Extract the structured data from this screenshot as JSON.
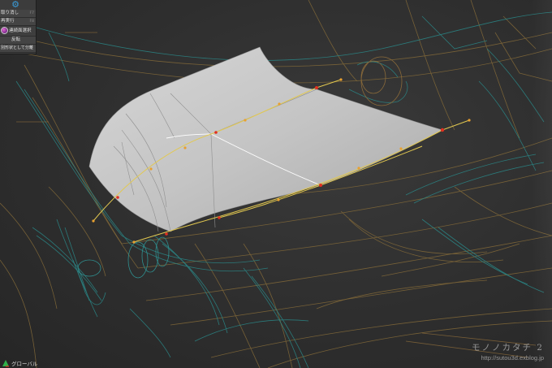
{
  "tool_panel": {
    "gear_icon": "gear-icon",
    "accent": "#3a9bd8",
    "items": [
      {
        "label": "取り消し",
        "shortcut": "F7"
      },
      {
        "label": "再実行",
        "shortcut": "F8"
      },
      {
        "label": "連続面選択",
        "icon": "sphere-icon"
      },
      {
        "label": "反転"
      },
      {
        "label": "別形状として分離"
      }
    ]
  },
  "global_button": {
    "label": "グローバル",
    "icon": "axis-icon"
  },
  "watermark": {
    "brand": "モノノカタチ 2",
    "url": "http://sutou3d.exblog.jp"
  },
  "colors": {
    "background": "#2e2e2e",
    "surface": "#bdbdbd",
    "wire_cyan": "#2f8f8f",
    "wire_orange": "#8a6a3a",
    "curve_yellow": "#e8d050",
    "control_red": "#e03020",
    "control_orange": "#e8a030"
  }
}
